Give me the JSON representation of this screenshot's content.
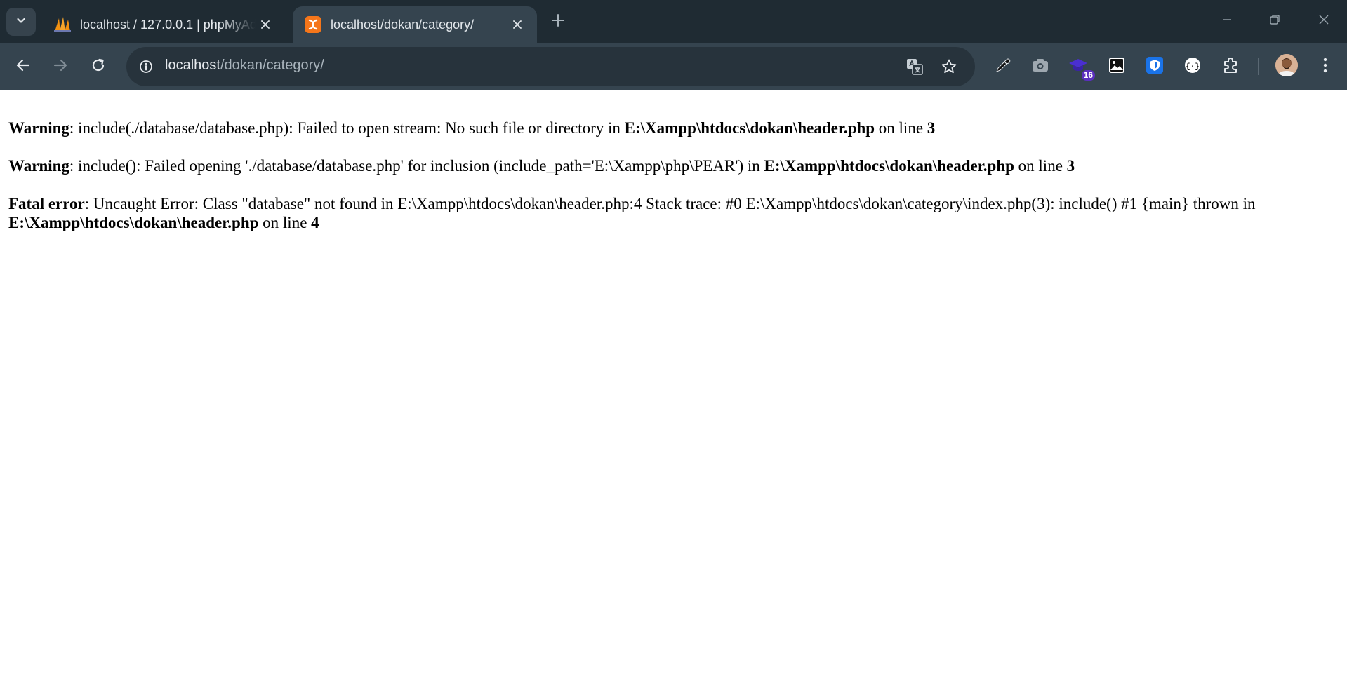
{
  "browser": {
    "tabs": [
      {
        "title": "localhost / 127.0.0.1 | phpMyAdmin",
        "favicon": "phpmyadmin-sails-icon",
        "active": false
      },
      {
        "title": "localhost/dokan/category/",
        "favicon": "xampp-icon",
        "active": true
      }
    ],
    "address": {
      "host": "localhost",
      "path": "/dokan/category/"
    },
    "extensions": [
      {
        "name": "color-picker-icon"
      },
      {
        "name": "screenshot-camera-icon"
      },
      {
        "name": "graduation-cap-icon",
        "badge": "16"
      },
      {
        "name": "image-icon"
      },
      {
        "name": "shield-extension-icon"
      },
      {
        "name": "code-braces-icon"
      },
      {
        "name": "extensions-puzzle-icon"
      }
    ],
    "accent": "#35444f",
    "tabstrip_color": "#1f2b33"
  },
  "page": {
    "warning1": {
      "label": "Warning",
      "text": ": include(./database/database.php): Failed to open stream: No such file or directory in ",
      "file": "E:\\Xampp\\htdocs\\dokan\\header.php",
      "online": " on line ",
      "line": "3"
    },
    "warning2": {
      "label": "Warning",
      "text": ": include(): Failed opening './database/database.php' for inclusion (include_path='E:\\Xampp\\php\\PEAR') in ",
      "file": "E:\\Xampp\\htdocs\\dokan\\header.php",
      "online": " on line ",
      "line": "3"
    },
    "fatal": {
      "label": "Fatal error",
      "text": ": Uncaught Error: Class \"database\" not found in E:\\Xampp\\htdocs\\dokan\\header.php:4 Stack trace: #0 E:\\Xampp\\htdocs\\dokan\\category\\index.php(3): include() #1 {main} thrown in ",
      "file": "E:\\Xampp\\htdocs\\dokan\\header.php",
      "online": " on line ",
      "line": "4"
    }
  }
}
